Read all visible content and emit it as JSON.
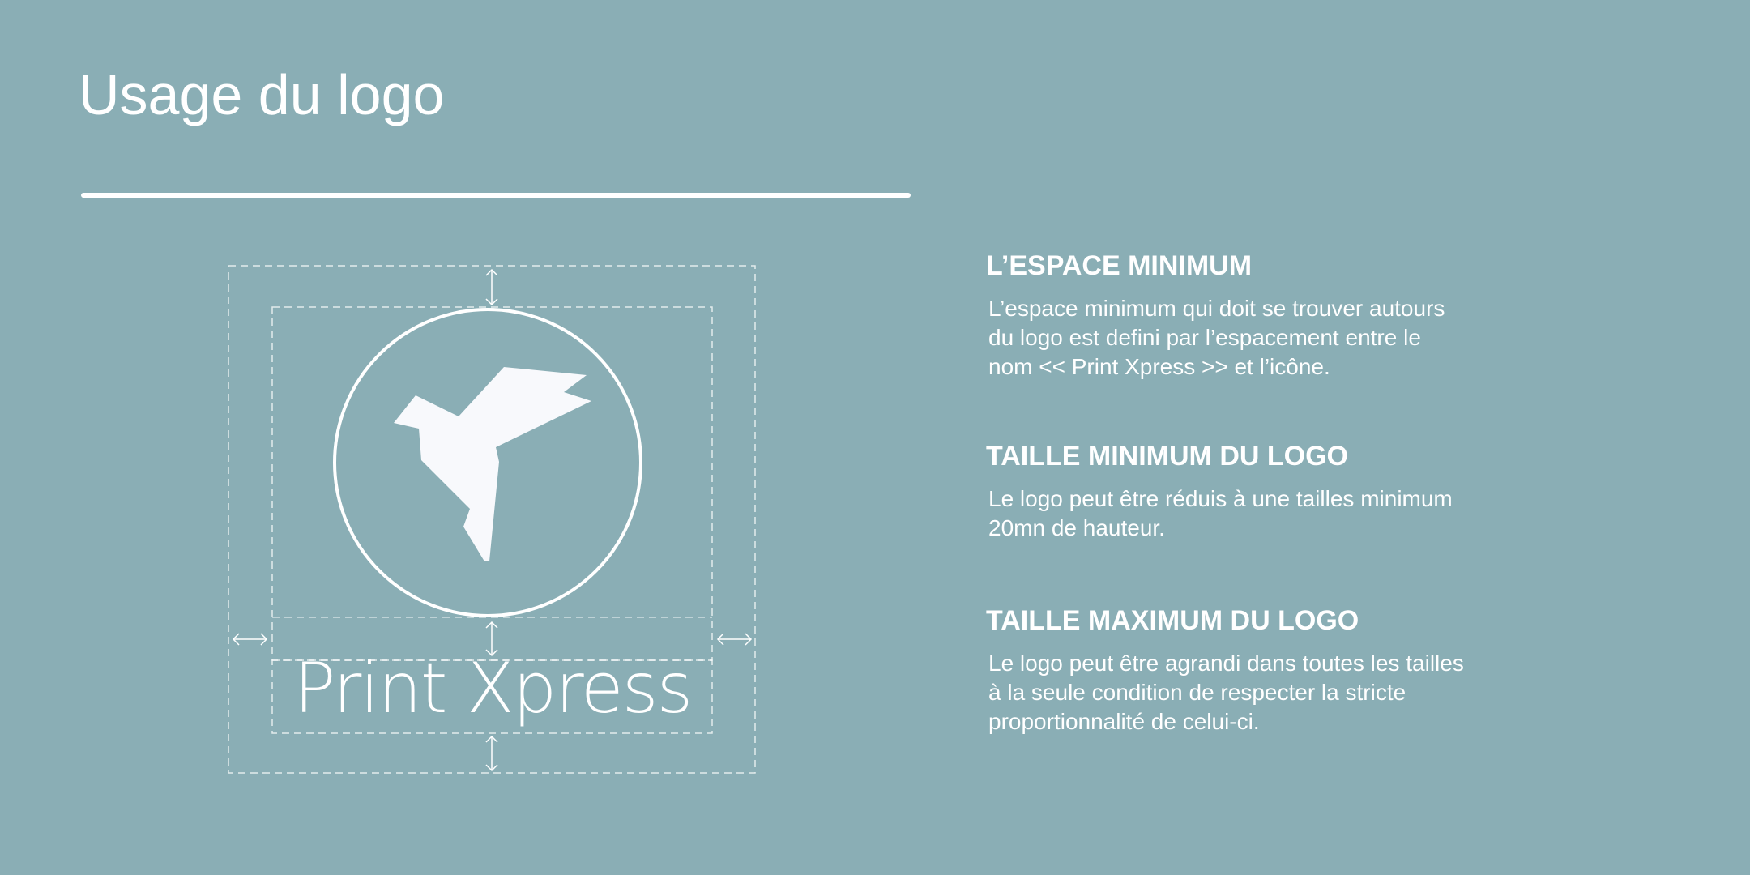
{
  "page": {
    "title": "Usage du logo",
    "background_color": "#8aaeb5",
    "accent_color": "#ffffff"
  },
  "logo": {
    "wordmark": "Print Xpress",
    "icon": "origami-bird-icon"
  },
  "sections": [
    {
      "heading": "L’ESPACE MINIMUM",
      "lines": [
        "L’espace minimum qui doit se trouver autours",
        "du logo est defini par l’espacement entre le",
        "nom << Print Xpress >> et l’icône."
      ]
    },
    {
      "heading": "TAILLE MINIMUM DU LOGO",
      "lines": [
        "Le logo peut être réduis à une tailles minimum",
        "20mn de hauteur."
      ]
    },
    {
      "heading": "TAILLE MAXIMUM DU LOGO",
      "lines": [
        "Le logo peut être agrandi dans toutes les tailles",
        "à la seule condition de respecter la stricte",
        "proportionnalité de celui-ci."
      ]
    }
  ]
}
